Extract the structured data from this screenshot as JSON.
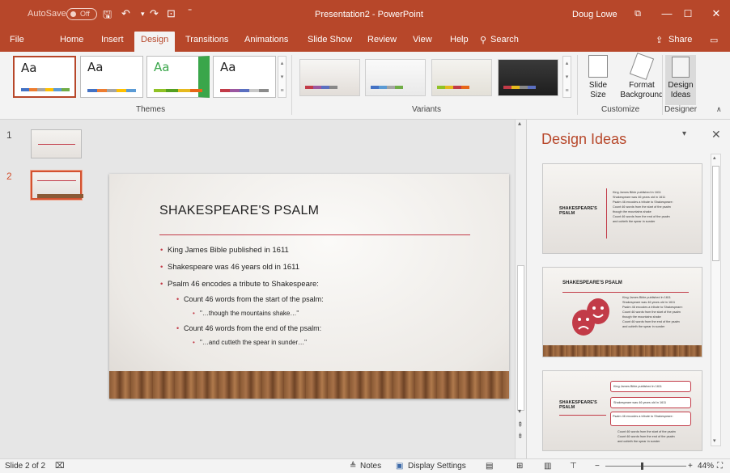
{
  "titlebar": {
    "autosave": "AutoSave",
    "autosave_state": "Off",
    "doc_title": "Presentation2 - PowerPoint",
    "user": "Doug Lowe"
  },
  "tabs": [
    "File",
    "Home",
    "Insert",
    "Design",
    "Transitions",
    "Animations",
    "Slide Show",
    "Review",
    "View",
    "Help",
    "Search"
  ],
  "share_label": "Share",
  "ribbon": {
    "themes_label": "Themes",
    "variants_label": "Variants",
    "customize_label": "Customize",
    "designer_label": "Designer",
    "theme_glyph": "Aa",
    "slide_size": {
      "line1": "Slide",
      "line2": "Size"
    },
    "format_bg": {
      "line1": "Format",
      "line2": "Background"
    },
    "design_ideas": {
      "line1": "Design",
      "line2": "Ideas"
    }
  },
  "slides_pane": {
    "num1": "1",
    "num2": "2"
  },
  "slide": {
    "title": "SHAKESPEARE'S PSALM",
    "b1": "King James Bible published in 1611",
    "b2": "Shakespeare was 46 years old in 1611",
    "b3": "Psalm 46 encodes a tribute to Shakespeare:",
    "b4": "Count 46 words from the start of the psalm:",
    "b5": "\"…though the mountains shake…\"",
    "b6": "Count 46 words from the end of the psalm:",
    "b7": "\"…and cutteth the spear in sunder…\""
  },
  "design_pane": {
    "title": "Design Ideas",
    "idea1_title": "SHAKESPEARE'S PSALM",
    "idea2_title": "SHAKESPEARE'S PSALM",
    "idea3_title": "SHAKESPEARE'S PSALM",
    "idea_b1": "King James Bible published in 1611",
    "idea_b2": "Shakespeare was 46 years old in 1611",
    "idea_b3": "Psalm 46 encodes a tribute to Shakespeare:",
    "idea_b4": "Count 46 words from the start of the psalm",
    "idea_b5": "though the mountains shake",
    "idea_b6": "Count 46 words from the end of the psalm",
    "idea_b7": "and cutteth the spear in sunder"
  },
  "status": {
    "slide_of": "Slide 2 of 2",
    "notes": "Notes",
    "display": "Display Settings",
    "zoom": "44%"
  },
  "colors": {
    "accent": "#b7472a",
    "bullet": "#c23b48"
  }
}
